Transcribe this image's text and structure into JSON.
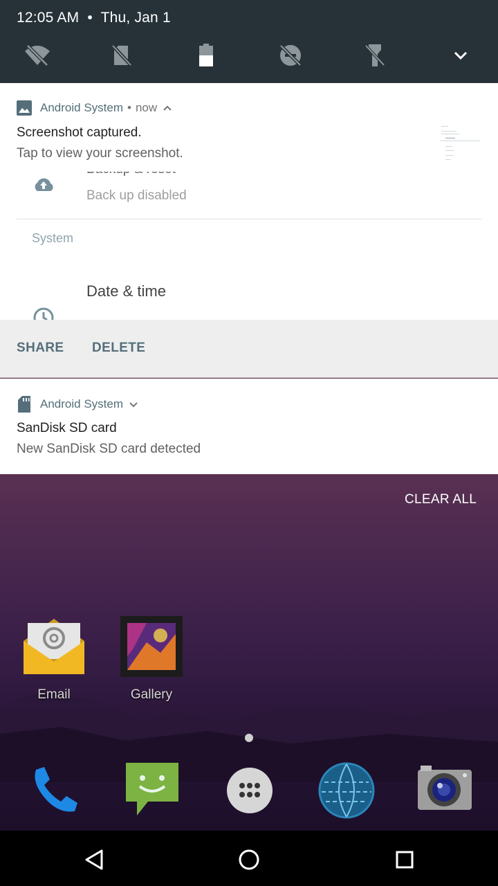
{
  "status": {
    "time": "12:05 AM",
    "separator": "•",
    "date": "Thu, Jan 1"
  },
  "quick_settings": {
    "icons": [
      "wifi-off-icon",
      "sim-off-icon",
      "battery-icon",
      "do-not-disturb-off-icon",
      "flashlight-off-icon",
      "expand-icon"
    ]
  },
  "notification1": {
    "app": "Android System",
    "dot": "•",
    "when": "now",
    "title": "Screenshot captured.",
    "text": "Tap to view your screenshot.",
    "preview": {
      "cut_title": "Backup & reset",
      "subtitle": "Back up disabled",
      "section": "System",
      "item": "Date & time"
    },
    "actions": {
      "share": "SHARE",
      "delete": "DELETE"
    }
  },
  "notification2": {
    "app": "Android System",
    "title": "SanDisk SD card",
    "text": "New SanDisk SD card detected"
  },
  "clear_all": "CLEAR ALL",
  "home": {
    "apps": [
      {
        "label": "Email"
      },
      {
        "label": "Gallery"
      }
    ],
    "dock": [
      "phone-icon",
      "messaging-icon",
      "app-drawer-icon",
      "browser-icon",
      "camera-icon"
    ]
  },
  "colors": {
    "qs_bg": "#263238",
    "accent": "#546e7a"
  }
}
